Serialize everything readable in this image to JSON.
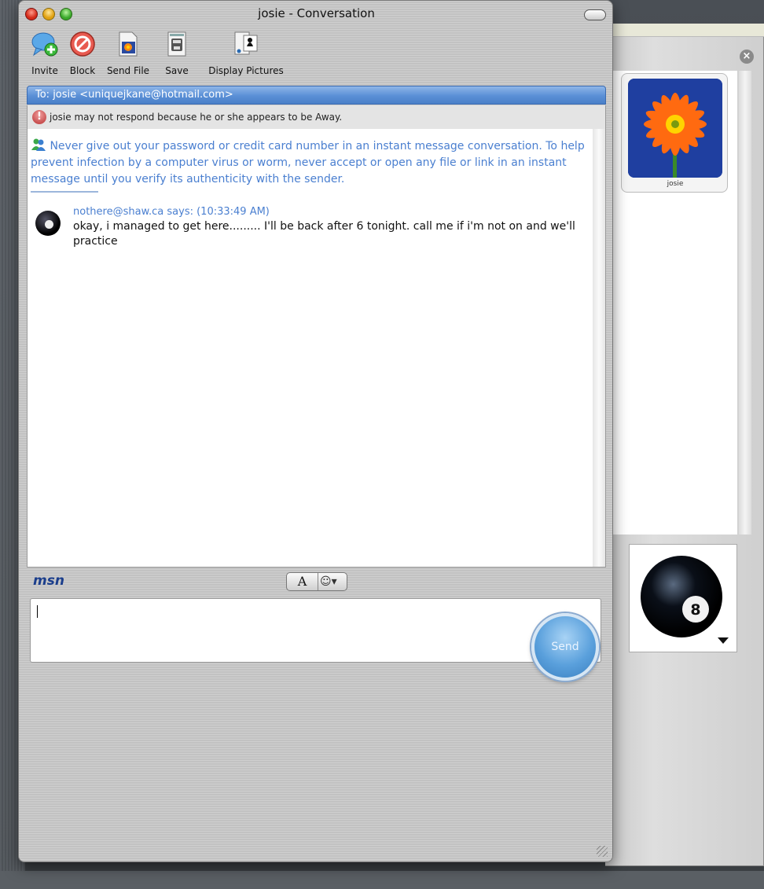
{
  "window": {
    "title": "josie - Conversation"
  },
  "toolbar": {
    "items": [
      {
        "label": "Invite",
        "icon": "invite-icon"
      },
      {
        "label": "Block",
        "icon": "block-icon"
      },
      {
        "label": "Send File",
        "icon": "send-file-icon"
      },
      {
        "label": "Save",
        "icon": "save-icon"
      },
      {
        "label": "Display Pictures",
        "icon": "display-pictures-icon"
      }
    ]
  },
  "recipient": {
    "to_line": "To: josie <uniquejkane@hotmail.com>",
    "away_notice": "josie may not respond because he or she appears to be Away."
  },
  "conversation": {
    "warning": "Never give out your password or credit card number in an instant message conversation. To help prevent infection by a computer virus or worm, never accept or open any file or link in an instant message until you verify its authenticity with the sender.",
    "messages": [
      {
        "sender_line": "nothere@shaw.ca says: (10:33:49 AM)",
        "text": "okay, i managed to get here......... I'll be back after 6 tonight. call me if i'm not on and we'll practice"
      }
    ]
  },
  "composer": {
    "logo": "msn",
    "font_button": "A",
    "emoticon_button": "☺▾",
    "send_label": "Send"
  },
  "contact_panel": {
    "contact_name": "josie"
  },
  "colors": {
    "accent_blue": "#4a7fd0",
    "to_bar": "#5a8fd6"
  }
}
